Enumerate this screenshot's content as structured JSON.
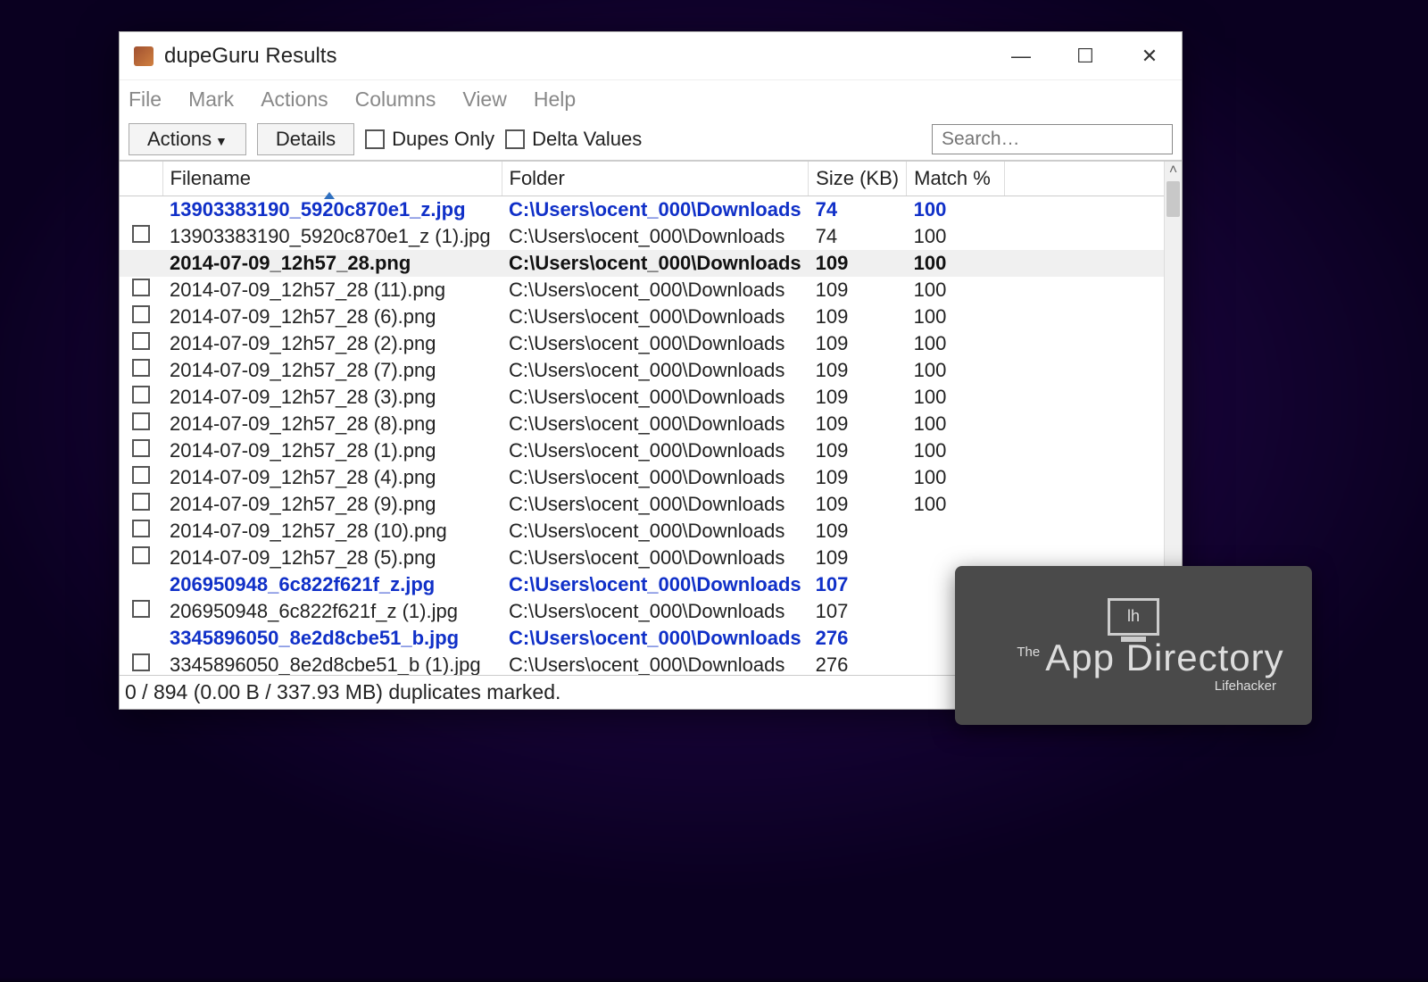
{
  "window": {
    "title": "dupeGuru Results"
  },
  "menu": [
    "File",
    "Mark",
    "Actions",
    "Columns",
    "View",
    "Help"
  ],
  "toolbar": {
    "actions_label": "Actions",
    "details_label": "Details",
    "dupes_only_label": "Dupes Only",
    "delta_values_label": "Delta Values",
    "search_placeholder": "Search…"
  },
  "columns": {
    "filename": "Filename",
    "folder": "Folder",
    "size": "Size (KB)",
    "match": "Match %"
  },
  "rows": [
    {
      "group": true,
      "checkbox": false,
      "filename": "13903383190_5920c870e1_z.jpg",
      "folder": "C:\\Users\\ocent_000\\Downloads",
      "size": "74",
      "match": "100"
    },
    {
      "group": false,
      "checkbox": true,
      "filename": "13903383190_5920c870e1_z (1).jpg",
      "folder": "C:\\Users\\ocent_000\\Downloads",
      "size": "74",
      "match": "100"
    },
    {
      "group": true,
      "selected": true,
      "checkbox": false,
      "filename": "2014-07-09_12h57_28.png",
      "folder": "C:\\Users\\ocent_000\\Downloads",
      "size": "109",
      "match": "100"
    },
    {
      "group": false,
      "checkbox": true,
      "filename": "2014-07-09_12h57_28 (11).png",
      "folder": "C:\\Users\\ocent_000\\Downloads",
      "size": "109",
      "match": "100"
    },
    {
      "group": false,
      "checkbox": true,
      "filename": "2014-07-09_12h57_28 (6).png",
      "folder": "C:\\Users\\ocent_000\\Downloads",
      "size": "109",
      "match": "100"
    },
    {
      "group": false,
      "checkbox": true,
      "filename": "2014-07-09_12h57_28 (2).png",
      "folder": "C:\\Users\\ocent_000\\Downloads",
      "size": "109",
      "match": "100"
    },
    {
      "group": false,
      "checkbox": true,
      "filename": "2014-07-09_12h57_28 (7).png",
      "folder": "C:\\Users\\ocent_000\\Downloads",
      "size": "109",
      "match": "100"
    },
    {
      "group": false,
      "checkbox": true,
      "filename": "2014-07-09_12h57_28 (3).png",
      "folder": "C:\\Users\\ocent_000\\Downloads",
      "size": "109",
      "match": "100"
    },
    {
      "group": false,
      "checkbox": true,
      "filename": "2014-07-09_12h57_28 (8).png",
      "folder": "C:\\Users\\ocent_000\\Downloads",
      "size": "109",
      "match": "100"
    },
    {
      "group": false,
      "checkbox": true,
      "filename": "2014-07-09_12h57_28 (1).png",
      "folder": "C:\\Users\\ocent_000\\Downloads",
      "size": "109",
      "match": "100"
    },
    {
      "group": false,
      "checkbox": true,
      "filename": "2014-07-09_12h57_28 (4).png",
      "folder": "C:\\Users\\ocent_000\\Downloads",
      "size": "109",
      "match": "100"
    },
    {
      "group": false,
      "checkbox": true,
      "filename": "2014-07-09_12h57_28 (9).png",
      "folder": "C:\\Users\\ocent_000\\Downloads",
      "size": "109",
      "match": "100"
    },
    {
      "group": false,
      "checkbox": true,
      "filename": "2014-07-09_12h57_28 (10).png",
      "folder": "C:\\Users\\ocent_000\\Downloads",
      "size": "109",
      "match": ""
    },
    {
      "group": false,
      "checkbox": true,
      "filename": "2014-07-09_12h57_28 (5).png",
      "folder": "C:\\Users\\ocent_000\\Downloads",
      "size": "109",
      "match": ""
    },
    {
      "group": true,
      "checkbox": false,
      "filename": "206950948_6c822f621f_z.jpg",
      "folder": "C:\\Users\\ocent_000\\Downloads",
      "size": "107",
      "match": ""
    },
    {
      "group": false,
      "checkbox": true,
      "filename": "206950948_6c822f621f_z (1).jpg",
      "folder": "C:\\Users\\ocent_000\\Downloads",
      "size": "107",
      "match": ""
    },
    {
      "group": true,
      "checkbox": false,
      "filename": "3345896050_8e2d8cbe51_b.jpg",
      "folder": "C:\\Users\\ocent_000\\Downloads",
      "size": "276",
      "match": ""
    },
    {
      "group": false,
      "checkbox": true,
      "filename": "3345896050_8e2d8cbe51_b (1).jpg",
      "folder": "C:\\Users\\ocent_000\\Downloads",
      "size": "276",
      "match": ""
    }
  ],
  "status": "0 / 894 (0.00 B / 337.93 MB) duplicates marked.",
  "badge": {
    "monitor_text": "lh",
    "line1": "The",
    "line2": "App Directory",
    "line3": "Lifehacker"
  }
}
